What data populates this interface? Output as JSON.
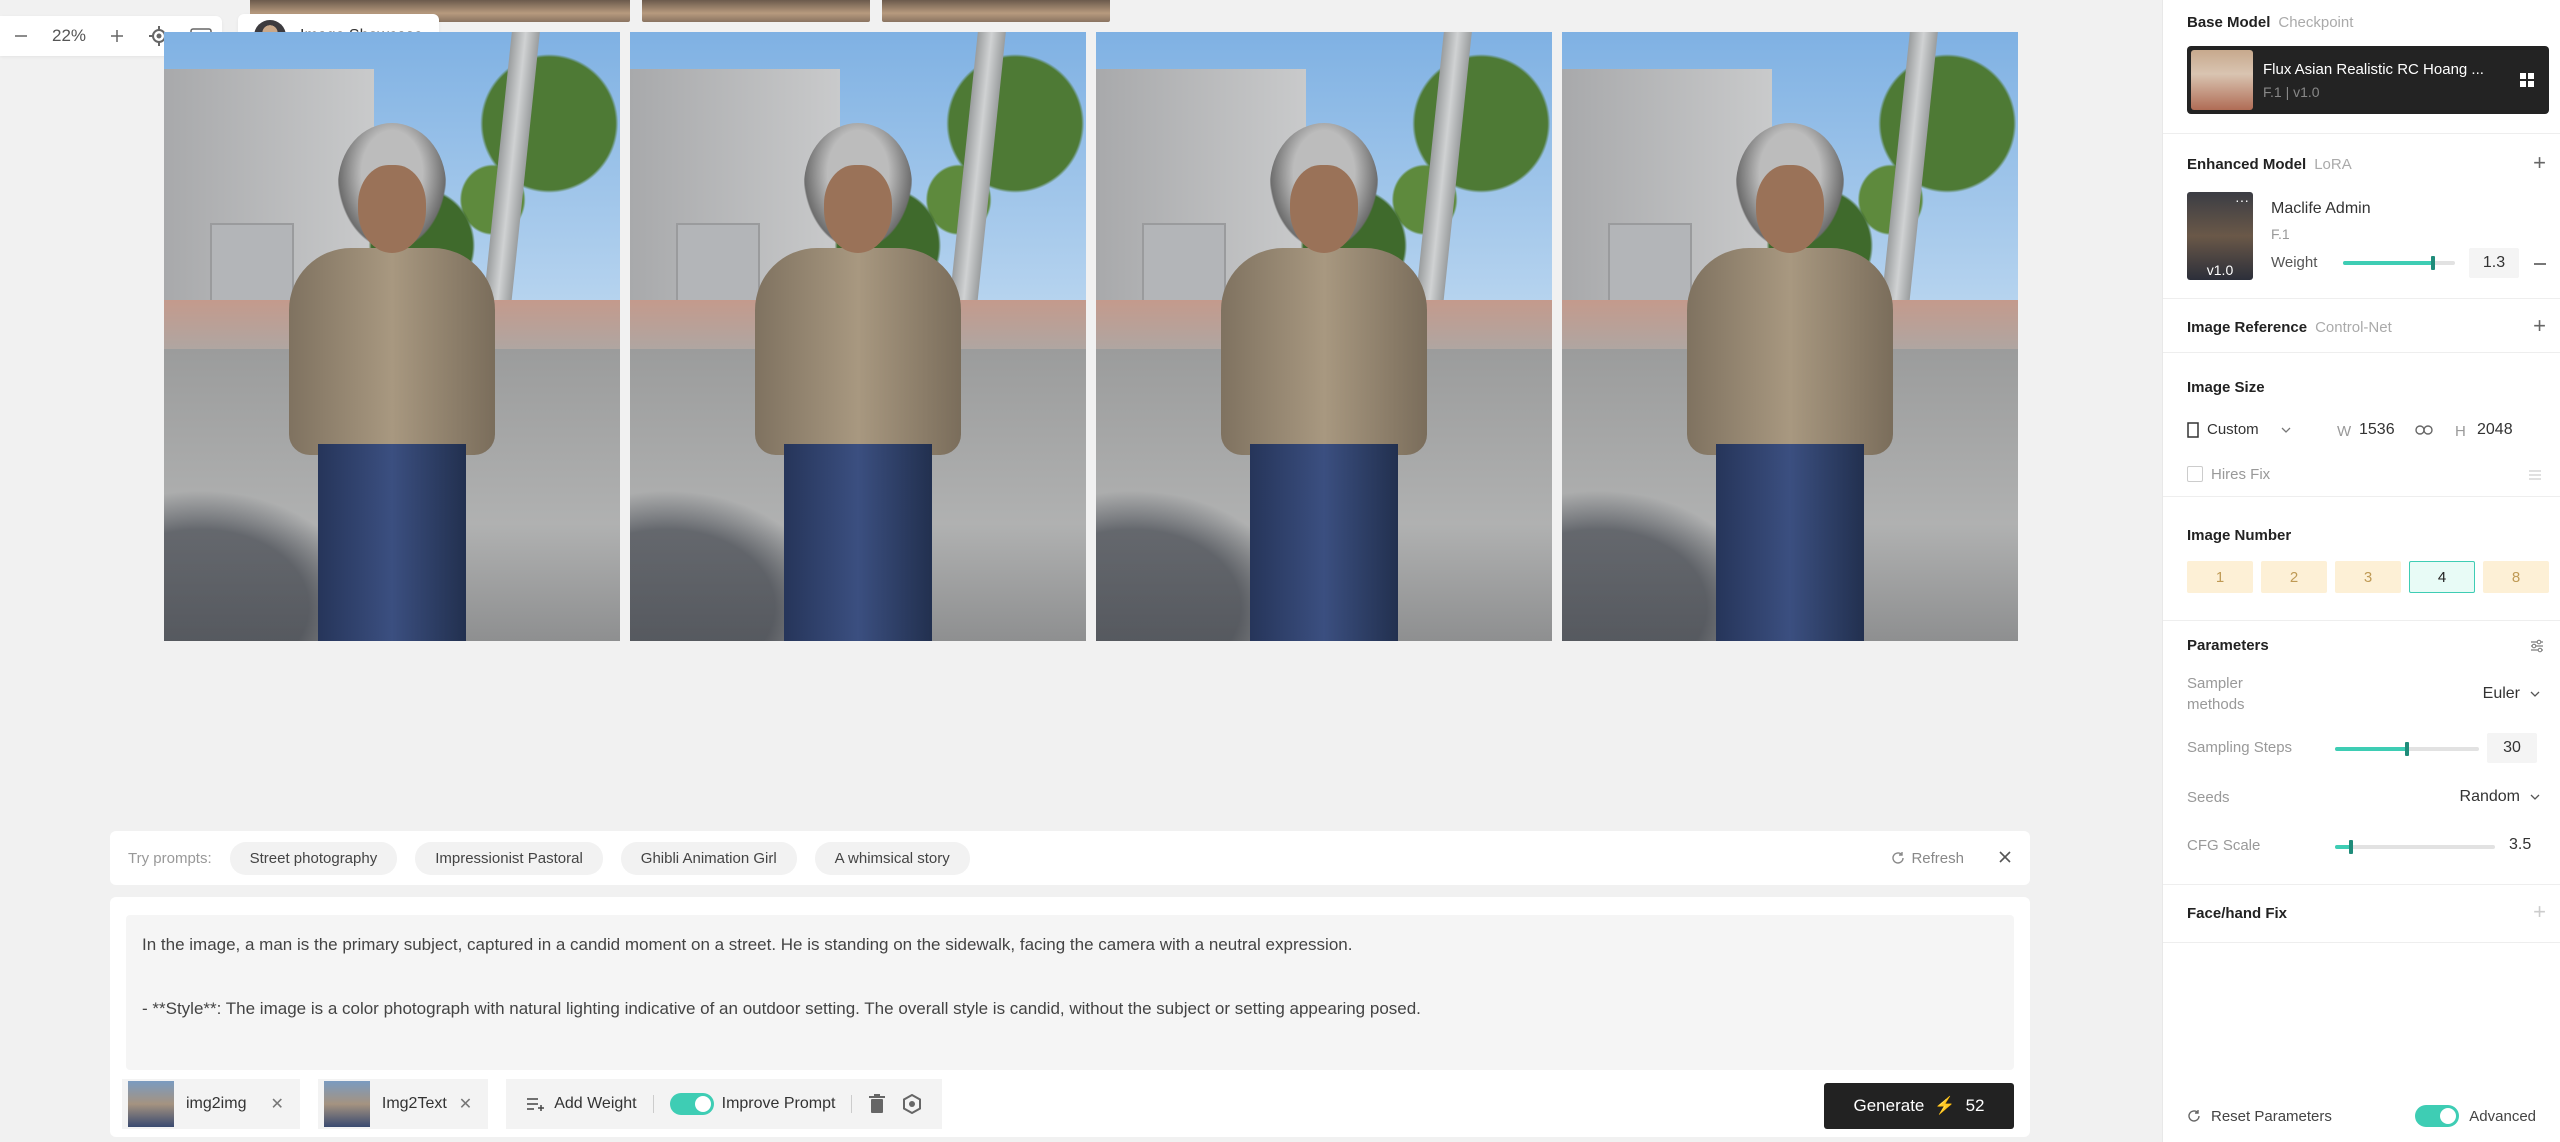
{
  "toolbar": {
    "zoom": "22%",
    "showcase_label": "Image Showcase"
  },
  "images": [
    {
      "alt": "generated-image-1"
    },
    {
      "alt": "generated-image-2"
    },
    {
      "alt": "generated-image-3"
    },
    {
      "alt": "generated-image-4"
    }
  ],
  "try_prompts": {
    "label": "Try prompts:",
    "chips": [
      "Street photography",
      "Impressionist Pastoral",
      "Ghibli Animation Girl",
      "A whimsical story"
    ],
    "refresh": "Refresh"
  },
  "prompt": {
    "line1": "In the image, a man is the primary subject, captured in a candid moment on a street. He is standing on the sidewalk, facing the camera with a neutral expression.",
    "line2": "- **Style**: The image is a color photograph with natural lighting indicative of an outdoor setting. The overall style is candid, without the subject or setting appearing posed."
  },
  "bottom_tools": {
    "img2img": "img2img",
    "img2text": "Img2Text",
    "add_weight": "Add Weight",
    "improve_prompt": "Improve Prompt"
  },
  "generate": {
    "label": "Generate",
    "cost": "52"
  },
  "panel": {
    "base_model": {
      "title": "Base Model",
      "sub": "Checkpoint",
      "name": "Flux Asian Realistic RC Hoang ...",
      "version": "F.1 | v1.0"
    },
    "enhanced_model": {
      "title": "Enhanced Model",
      "sub": "LoRA",
      "name": "Maclife Admin",
      "base": "F.1",
      "version": "v1.0",
      "weight_label": "Weight",
      "weight": "1.3",
      "weight_fraction": 0.8
    },
    "image_reference": {
      "title": "Image Reference",
      "sub": "Control-Net"
    },
    "image_size": {
      "title": "Image Size",
      "preset": "Custom",
      "w_label": "W",
      "w": "1536",
      "h_label": "H",
      "h": "2048",
      "hires": "Hires Fix"
    },
    "image_number": {
      "title": "Image Number",
      "options": [
        "1",
        "2",
        "3",
        "4",
        "8"
      ],
      "selected": "4"
    },
    "parameters": {
      "title": "Parameters",
      "sampler_label": "Sampler methods",
      "sampler": "Euler",
      "steps_label": "Sampling Steps",
      "steps": "30",
      "steps_fraction": 0.5,
      "seeds_label": "Seeds",
      "seeds": "Random",
      "cfg_label": "CFG Scale",
      "cfg": "3.5",
      "cfg_fraction": 0.1
    },
    "face_fix": {
      "title": "Face/hand Fix"
    },
    "footer": {
      "reset": "Reset Parameters",
      "advanced": "Advanced"
    }
  },
  "colors": {
    "accent": "#3ecdb4",
    "generate_bg": "#222222",
    "number_bg": "#fdf0d6"
  }
}
